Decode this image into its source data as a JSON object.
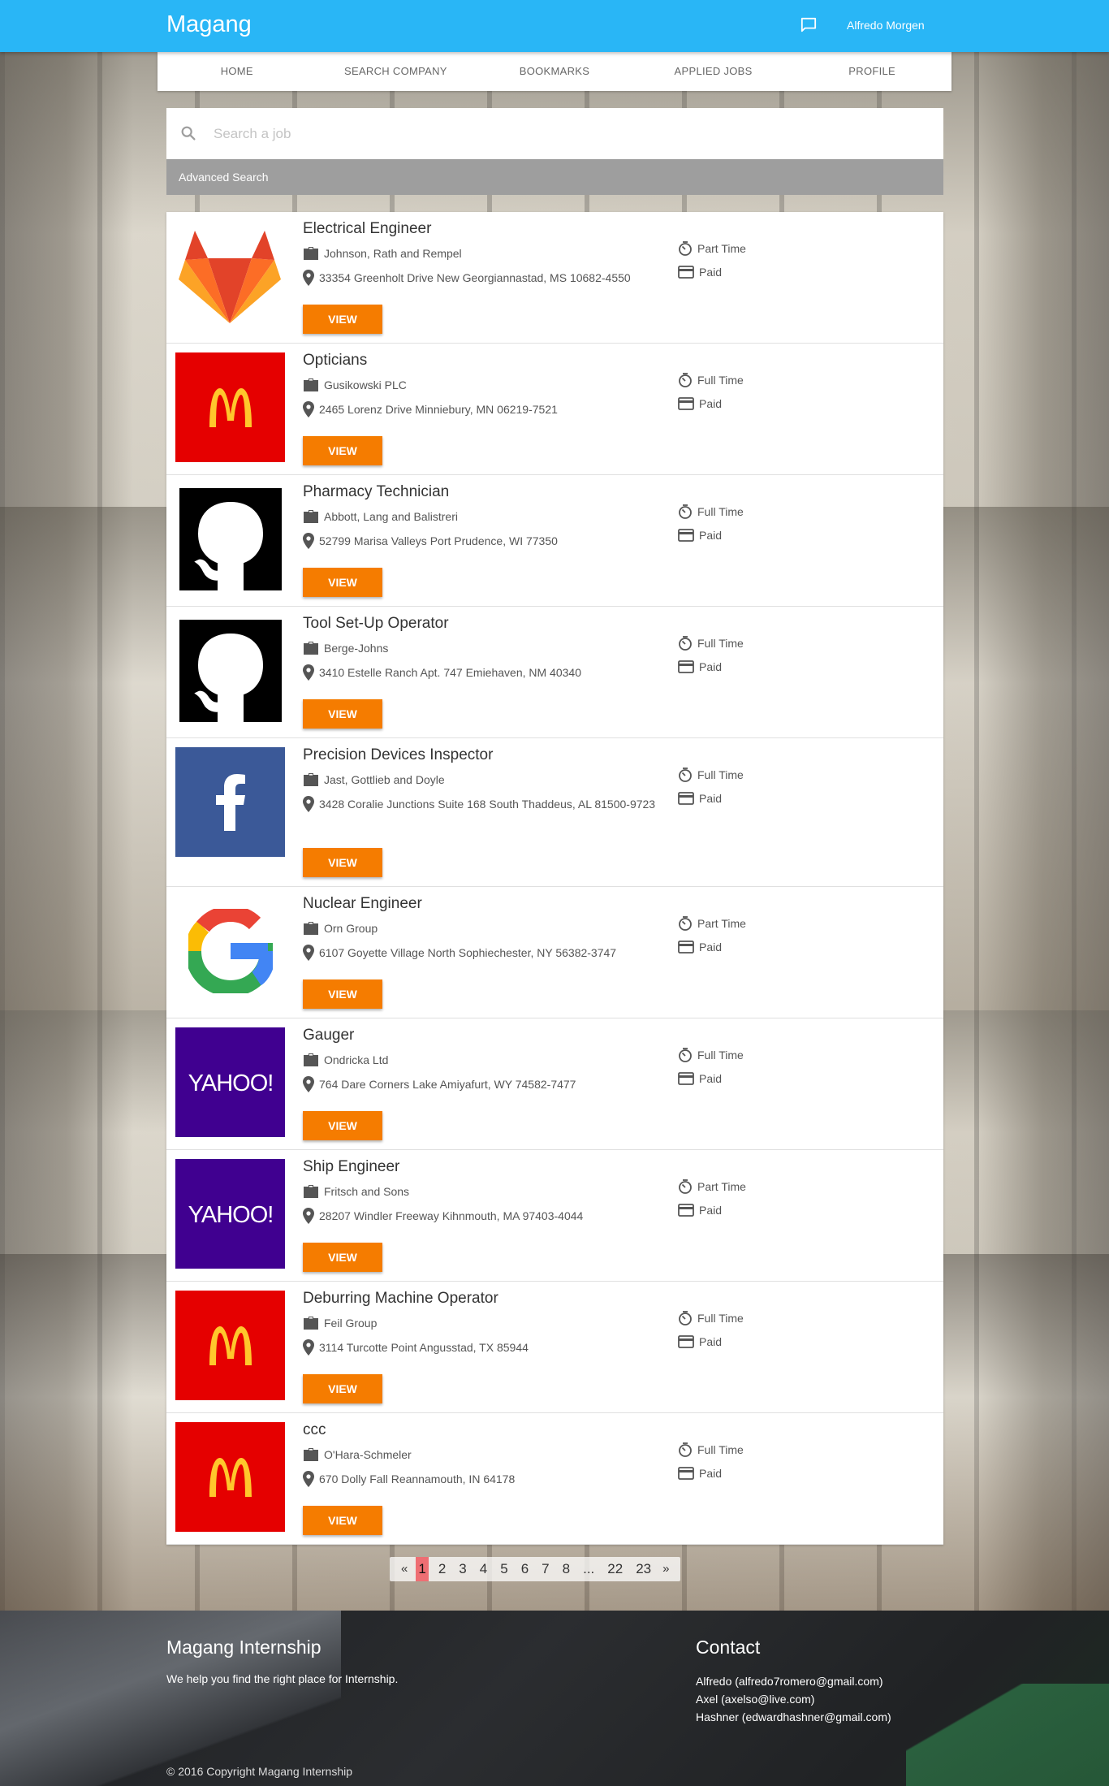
{
  "appbar": {
    "brand": "Magang",
    "user_name": "Alfredo Morgen",
    "color": "#29b6f6"
  },
  "nav": {
    "tabs": [
      "HOME",
      "SEARCH COMPANY",
      "BOOKMARKS",
      "APPLIED JOBS",
      "PROFILE"
    ]
  },
  "search": {
    "placeholder": "Search a job",
    "value": "",
    "advanced_label": "Advanced Search"
  },
  "jobs": [
    {
      "title": "Electrical Engineer",
      "company": "Johnson, Rath and Rempel",
      "address": "33354 Greenholt Drive New Georgiannastad, MS 10682-4550",
      "type": "Part Time",
      "pay": "Paid",
      "logo": "gitlab",
      "button": "VIEW"
    },
    {
      "title": "Opticians",
      "company": "Gusikowski PLC",
      "address": "2465 Lorenz Drive Minniebury, MN 06219-7521",
      "type": "Full Time",
      "pay": "Paid",
      "logo": "mcdonalds",
      "button": "VIEW"
    },
    {
      "title": "Pharmacy Technician",
      "company": "Abbott, Lang and Balistreri",
      "address": "52799 Marisa Valleys Port Prudence, WI 77350",
      "type": "Full Time",
      "pay": "Paid",
      "logo": "github",
      "button": "VIEW"
    },
    {
      "title": "Tool Set-Up Operator",
      "company": "Berge-Johns",
      "address": "3410 Estelle Ranch Apt. 747 Emiehaven, NM 40340",
      "type": "Full Time",
      "pay": "Paid",
      "logo": "github",
      "button": "VIEW"
    },
    {
      "title": "Precision Devices Inspector",
      "company": "Jast, Gottlieb and Doyle",
      "address": "3428 Coralie Junctions Suite 168 South Thaddeus, AL 81500-9723",
      "type": "Full Time",
      "pay": "Paid",
      "logo": "facebook",
      "button": "VIEW"
    },
    {
      "title": "Nuclear Engineer",
      "company": "Orn Group",
      "address": "6107 Goyette Village North Sophiechester, NY 56382-3747",
      "type": "Part Time",
      "pay": "Paid",
      "logo": "google",
      "button": "VIEW"
    },
    {
      "title": "Gauger",
      "company": "Ondricka Ltd",
      "address": "764 Dare Corners Lake Amiyafurt, WY 74582-7477",
      "type": "Full Time",
      "pay": "Paid",
      "logo": "yahoo",
      "button": "VIEW"
    },
    {
      "title": "Ship Engineer",
      "company": "Fritsch and Sons",
      "address": "28207 Windler Freeway Kihnmouth, MA 97403-4044",
      "type": "Part Time",
      "pay": "Paid",
      "logo": "yahoo",
      "button": "VIEW"
    },
    {
      "title": "Deburring Machine Operator",
      "company": "Feil Group",
      "address": "3114 Turcotte Point Angusstad, TX 85944",
      "type": "Full Time",
      "pay": "Paid",
      "logo": "mcdonalds",
      "button": "VIEW"
    },
    {
      "title": "ccc",
      "company": "O'Hara-Schmeler",
      "address": "670 Dolly Fall Reannamouth, IN 64178",
      "type": "Full Time",
      "pay": "Paid",
      "logo": "mcdonalds",
      "button": "VIEW"
    }
  ],
  "pagination": {
    "prev": "«",
    "next": "»",
    "current": "1",
    "pages": [
      "2",
      "3",
      "4",
      "5",
      "6",
      "7",
      "8",
      "...",
      "22",
      "23"
    ]
  },
  "footer": {
    "title": "Magang Internship",
    "description": "We help you find the right place for Internship.",
    "copyright": "© 2016 Copyright Magang Internship",
    "contact_title": "Contact",
    "contacts": [
      "Alfredo (alfredo7romero@gmail.com)",
      "Axel (axelso@live.com)",
      "Hashner (edwardhashner@gmail.com)"
    ]
  },
  "colors": {
    "accent": "#f57c00",
    "advanced_bar": "#9e9e9e",
    "active_page": "#ee6e73"
  },
  "icons": {
    "chat": "chat-bubble-icon",
    "search": "search-icon",
    "company": "briefcase-icon",
    "address": "map-pin-icon",
    "type": "timer-icon",
    "pay": "credit-card-icon"
  }
}
